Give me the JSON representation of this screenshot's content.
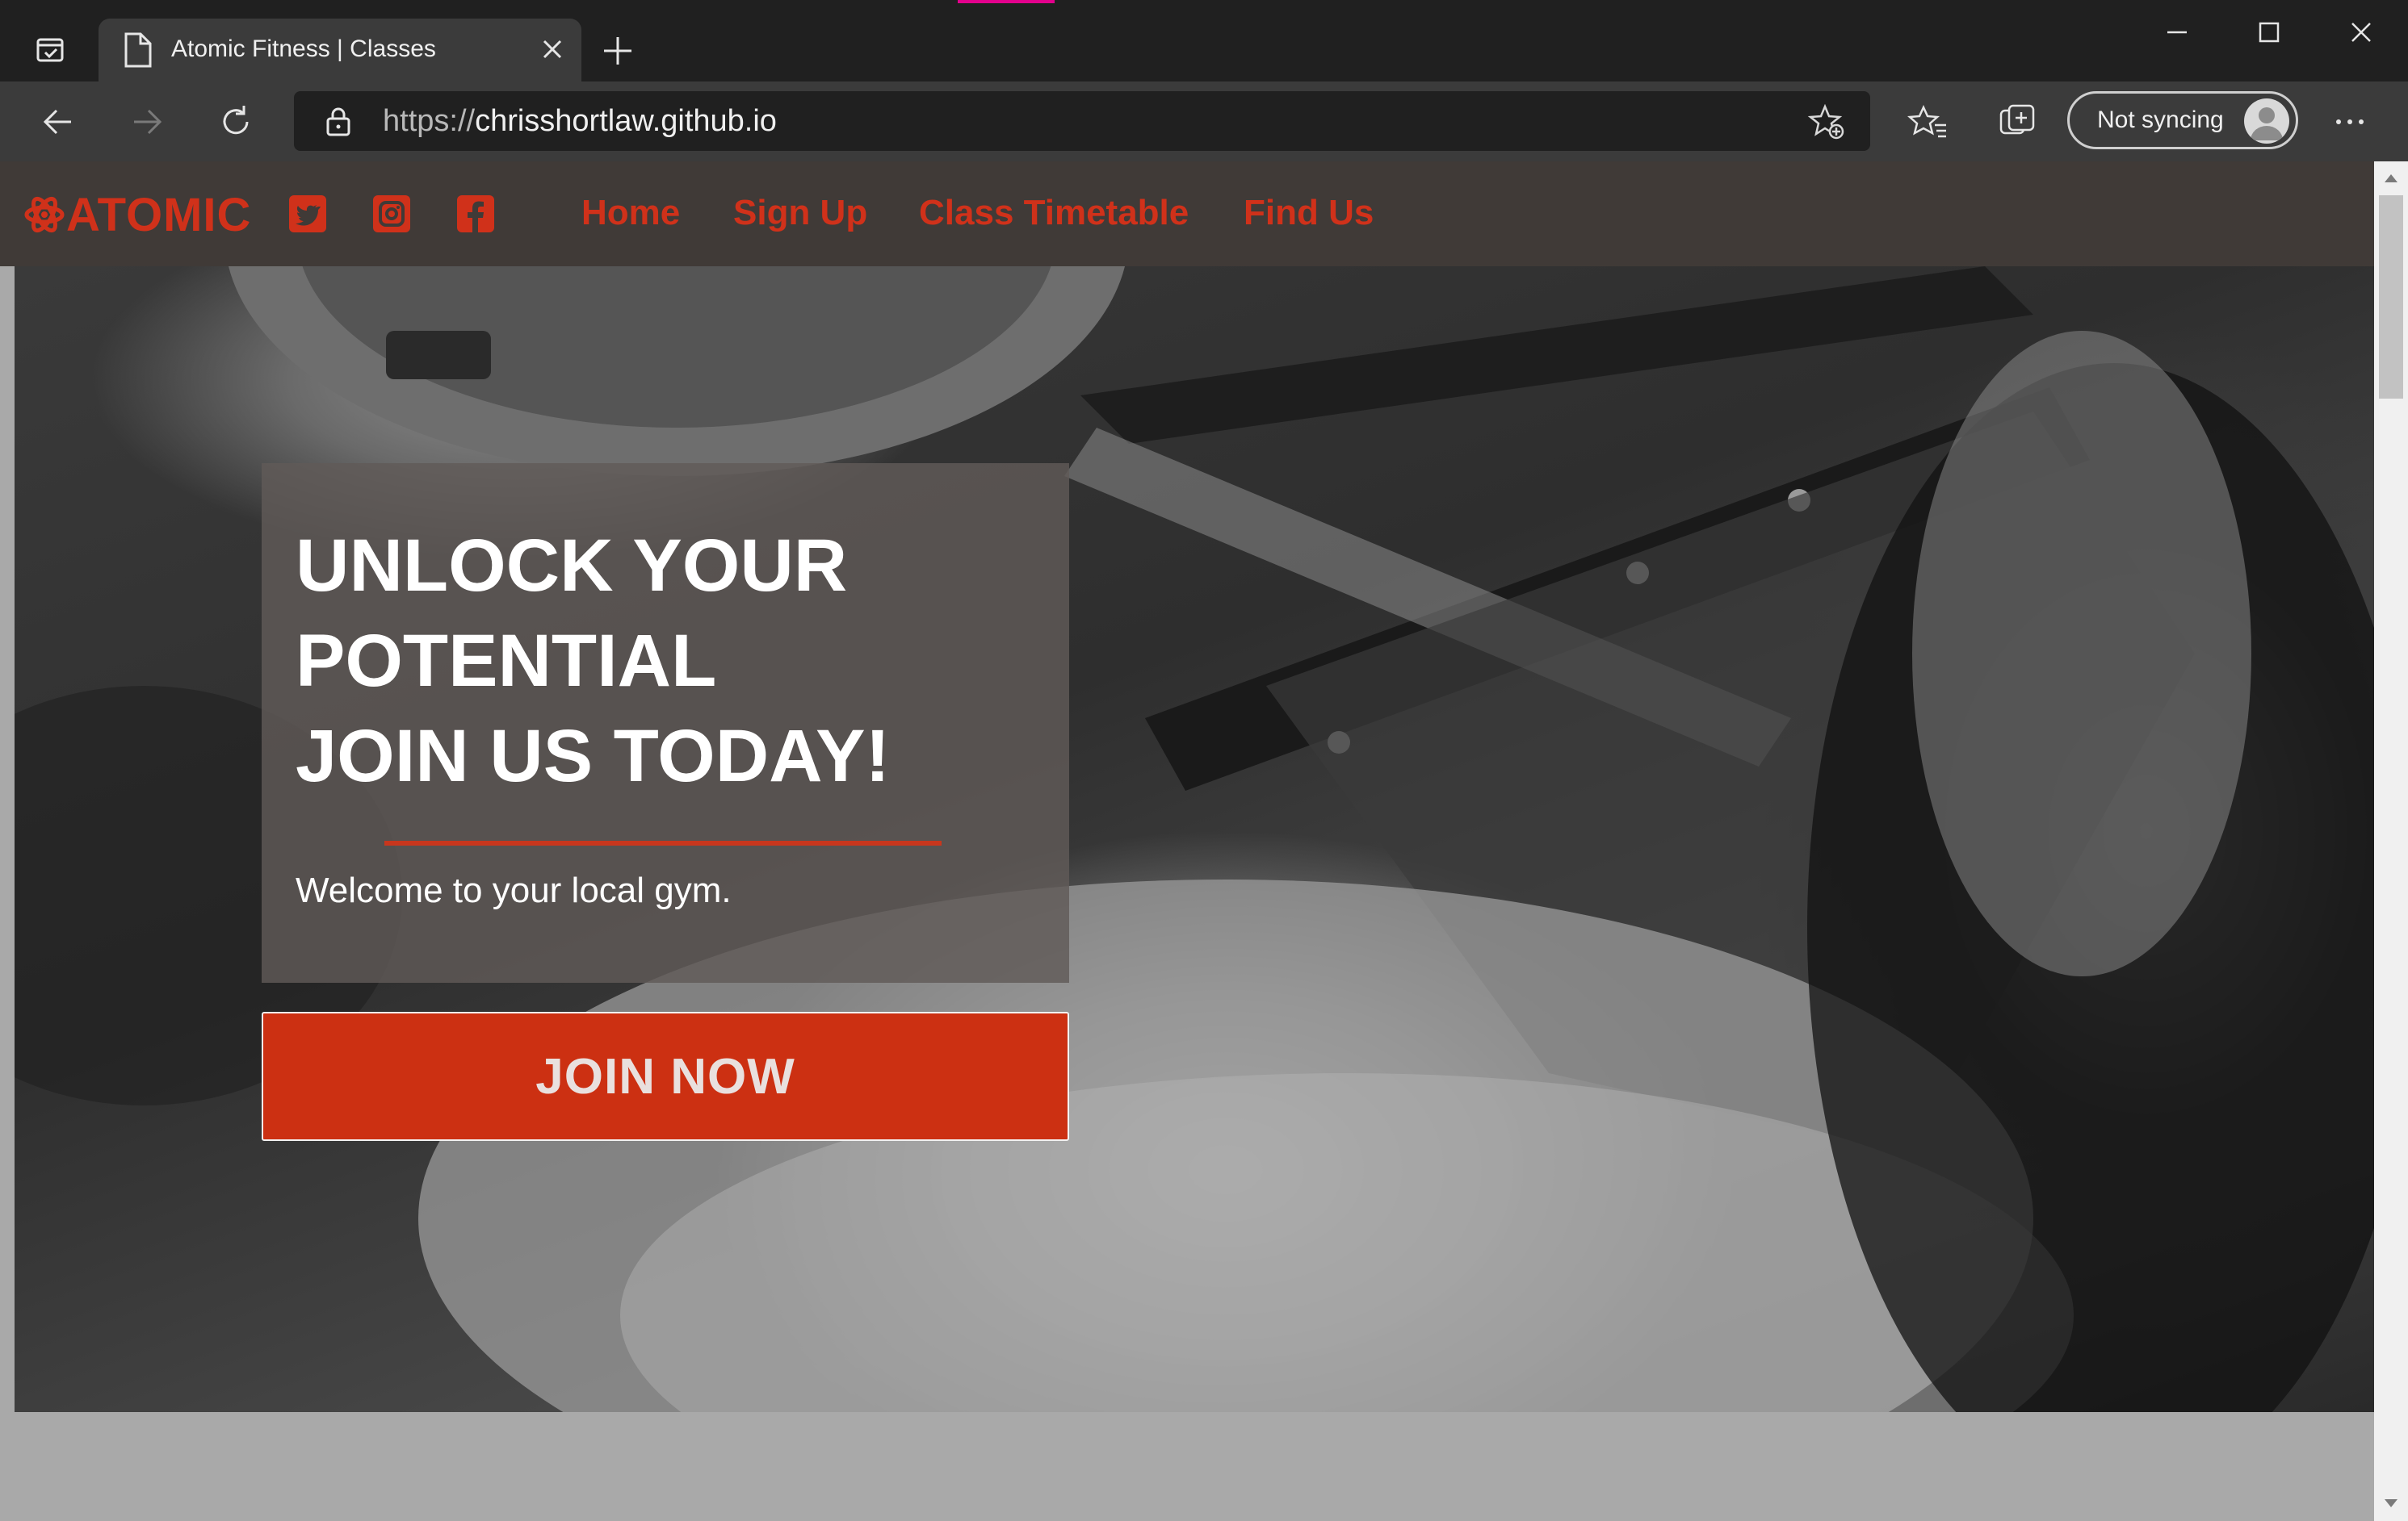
{
  "browser": {
    "tab_title": "Atomic Fitness | Classes",
    "url_scheme": "https://",
    "url_host": "chrisshortlaw.github.io",
    "sync_label": "Not syncing"
  },
  "site": {
    "logo_text": "ATOMIC",
    "nav": [
      "Home",
      "Sign Up",
      "Class Timetable",
      "Find Us"
    ],
    "social_icons": [
      "twitter-icon",
      "instagram-icon",
      "facebook-icon"
    ],
    "accent_color": "#d0311a"
  },
  "hero": {
    "headline": [
      "UNLOCK YOUR",
      "POTENTIAL",
      "JOIN US TODAY!"
    ],
    "subtitle": "Welcome to your local gym.",
    "cta": "JOIN NOW"
  }
}
